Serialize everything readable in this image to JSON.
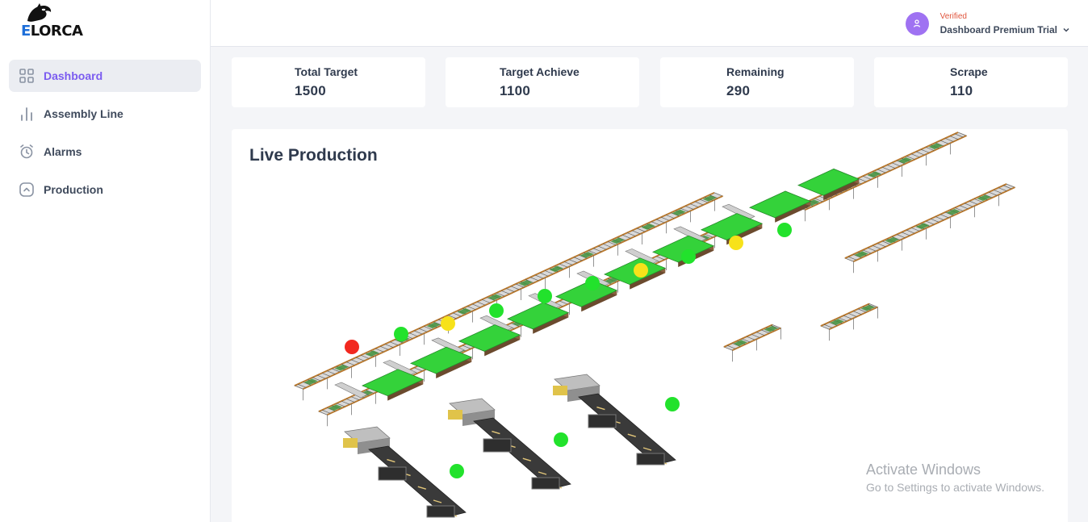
{
  "brand": {
    "logo_e": "E",
    "logo_rest": "LORCA"
  },
  "nav": {
    "items": [
      {
        "label": "Dashboard",
        "icon": "grid-icon",
        "active": true
      },
      {
        "label": "Assembly Line",
        "icon": "bar-chart-icon",
        "active": false
      },
      {
        "label": "Alarms",
        "icon": "alarm-clock-icon",
        "active": false
      },
      {
        "label": "Production",
        "icon": "chevron-up-square-icon",
        "active": false
      }
    ]
  },
  "user": {
    "status": "Verified",
    "plan": "Dashboard Premium Trial",
    "icon": "user-icon"
  },
  "stats": [
    {
      "title": "Total Target",
      "value": "1500"
    },
    {
      "title": "Target Achieve",
      "value": "1100"
    },
    {
      "title": "Remaining",
      "value": "290"
    },
    {
      "title": "Scrape",
      "value": "110"
    }
  ],
  "panel": {
    "title": "Live Production"
  },
  "status_colors": {
    "ok": "#22e22c",
    "warning": "#f7e21a",
    "alarm": "#f2281f"
  },
  "stations": {
    "upper": [
      "alarm",
      "ok",
      "warning",
      "ok",
      "ok",
      "ok",
      "warning",
      "ok",
      "warning",
      "ok"
    ],
    "lower": [
      "ok",
      "ok",
      "ok"
    ]
  },
  "watermark": {
    "line1": "Activate Windows",
    "line2": "Go to Settings to activate Windows."
  },
  "colors": {
    "accent": "#7b5cf0",
    "active_bg": "#ebedf2",
    "avatar": "#9f72f2",
    "verified": "#e0553d"
  }
}
